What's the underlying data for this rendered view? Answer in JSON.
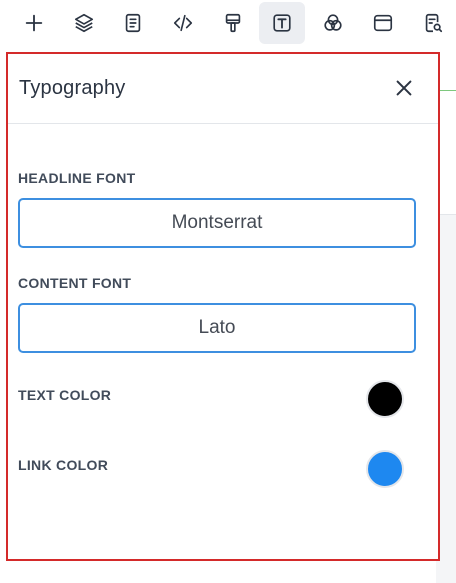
{
  "toolbar": {
    "items": [
      {
        "icon": "plus-icon"
      },
      {
        "icon": "layers-icon"
      },
      {
        "icon": "document-icon"
      },
      {
        "icon": "code-icon"
      },
      {
        "icon": "paint-roller-icon"
      },
      {
        "icon": "typography-icon",
        "active": true
      },
      {
        "icon": "color-circles-icon"
      },
      {
        "icon": "browser-window-icon"
      },
      {
        "icon": "page-search-icon"
      }
    ]
  },
  "panel": {
    "title": "Typography",
    "close_icon": "close-icon",
    "headline_font": {
      "label": "HEADLINE FONT",
      "value": "Montserrat"
    },
    "content_font": {
      "label": "CONTENT FONT",
      "value": "Lato"
    },
    "text_color": {
      "label": "TEXT COLOR",
      "value": "#000000"
    },
    "link_color": {
      "label": "LINK COLOR",
      "value": "#1e88f0"
    }
  },
  "colors": {
    "highlight_border": "#d42a2a",
    "field_border": "#3d8fe0",
    "active_tool_bg": "#eceef2"
  }
}
